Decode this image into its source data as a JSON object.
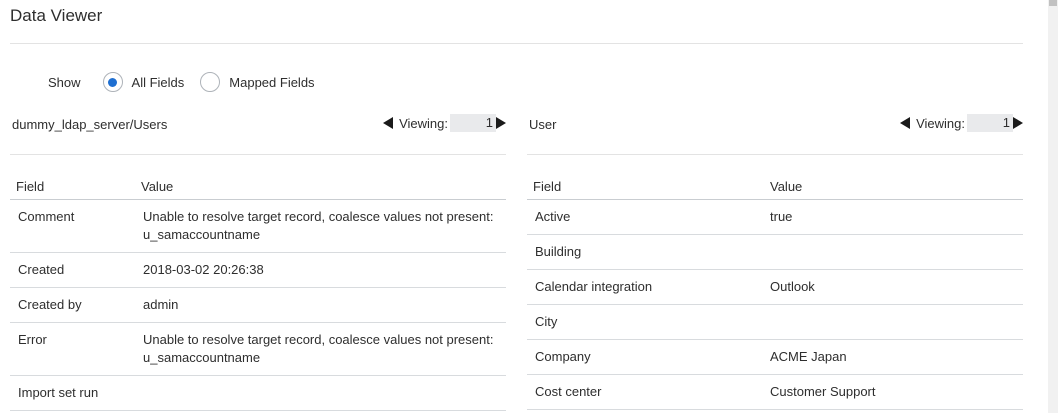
{
  "page": {
    "title": "Data Viewer"
  },
  "show": {
    "label": "Show",
    "options": [
      {
        "label": "All Fields",
        "checked": true
      },
      {
        "label": "Mapped Fields",
        "checked": false
      }
    ]
  },
  "left": {
    "name": "dummy_ldap_server/Users",
    "viewing_label": "Viewing:",
    "viewing_value": "1",
    "columns": [
      "Field",
      "Value"
    ],
    "rows": [
      {
        "field": "Comment",
        "value": "Unable to resolve target record, coalesce values not present: u_samaccountname"
      },
      {
        "field": "Created",
        "value": "2018-03-02 20:26:38"
      },
      {
        "field": "Created by",
        "value": "admin"
      },
      {
        "field": "Error",
        "value": "Unable to resolve target record, coalesce values not present: u_samaccountname"
      },
      {
        "field": "Import set run",
        "value": ""
      }
    ]
  },
  "right": {
    "name": "User",
    "viewing_label": "Viewing:",
    "viewing_value": "1",
    "columns": [
      "Field",
      "Value"
    ],
    "rows": [
      {
        "field": "Active",
        "value": "true"
      },
      {
        "field": "Building",
        "value": ""
      },
      {
        "field": "Calendar integration",
        "value": "Outlook"
      },
      {
        "field": "City",
        "value": ""
      },
      {
        "field": "Company",
        "value": "ACME Japan"
      },
      {
        "field": "Cost center",
        "value": "Customer Support"
      }
    ]
  }
}
